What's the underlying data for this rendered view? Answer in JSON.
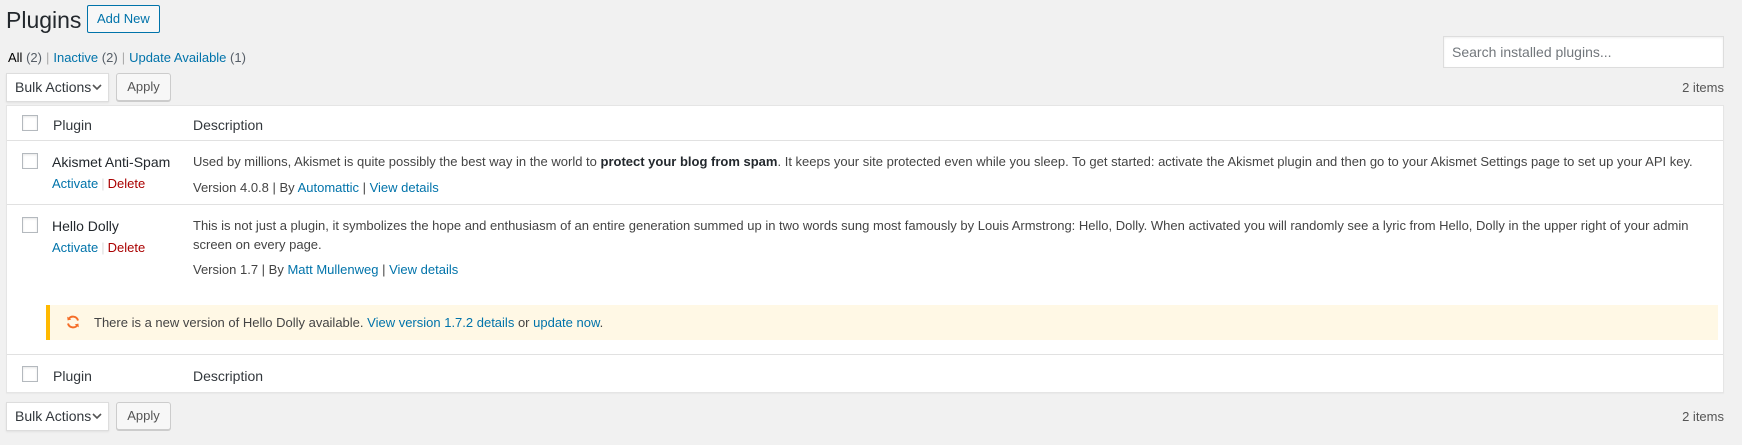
{
  "header": {
    "title": "Plugins",
    "add_new_label": "Add New"
  },
  "filters": {
    "all": "All",
    "all_count": "(2)",
    "inactive": "Inactive",
    "inactive_count": "(2)",
    "update_available": "Update Available",
    "update_count": "(1)",
    "separator": "|"
  },
  "search": {
    "placeholder": "Search installed plugins..."
  },
  "tablenav": {
    "bulk_actions": "Bulk Actions",
    "apply": "Apply",
    "items": "2 items"
  },
  "columns": {
    "plugin": "Plugin",
    "description": "Description"
  },
  "plugins": [
    {
      "name": "Akismet Anti-Spam",
      "activate": "Activate",
      "delete": "Delete",
      "desc_before": "Used by millions, Akismet is quite possibly the best way in the world to ",
      "desc_bold": "protect your blog from spam",
      "desc_after": ". It keeps your site protected even while you sleep. To get started: activate the Akismet plugin and then go to your Akismet Settings page to set up your API key.",
      "version": "Version 4.0.8",
      "by": "By",
      "author": "Automattic",
      "view_details": "View details"
    },
    {
      "name": "Hello Dolly",
      "activate": "Activate",
      "delete": "Delete",
      "desc_line1": "This is not just a plugin, it symbolizes the hope and enthusiasm of an entire generation summed up in two words sung most famously by Louis Armstrong: Hello, Dolly. When activated you will randomly see a lyric from Hello, Dolly in the upper right of your admin",
      "desc_line2": "screen on every page.",
      "version": "Version 1.7",
      "by": "By",
      "author": "Matt Mullenweg",
      "view_details": "View details"
    }
  ],
  "update_notice": {
    "text": "There is a new version of Hello Dolly available.",
    "view_link": "View version 1.7.2 details",
    "or": "or",
    "update_link": "update now",
    "end": "."
  },
  "icons": {
    "update": "update-icon",
    "dropdown": "chevron-down-icon"
  },
  "colors": {
    "link": "#0073aa",
    "delete": "#a00",
    "notice_border": "#ffb900",
    "notice_bg": "#fff8e5",
    "update_icon": "#f56e28"
  }
}
